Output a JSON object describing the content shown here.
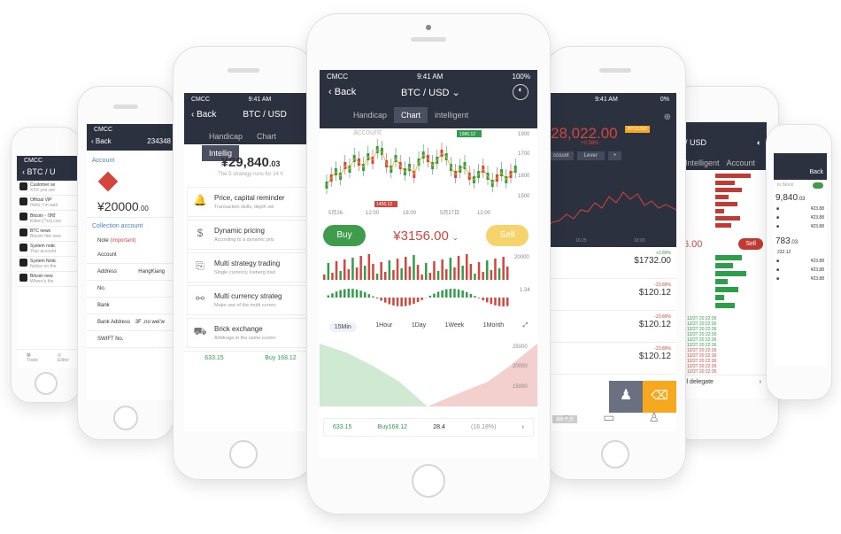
{
  "colors": {
    "dark": "#2c3140",
    "green": "#2f9e4a",
    "red": "#d4453d",
    "yellow": "#f6d36b",
    "orange": "#f5a623"
  },
  "p1": {
    "status": "CMCC",
    "title": "BTC / U",
    "news": [
      {
        "title": "Customer se",
        "sub": "XXX you are"
      },
      {
        "title": "Official VIP",
        "sub": "Hello, I'm wait"
      },
      {
        "title": "Bitcoin - 대략",
        "sub": "Kitten [?xx] coin"
      },
      {
        "title": "BTC news",
        "sub": "Bitcoin hits new"
      },
      {
        "title": "System notic",
        "sub": "Your account"
      },
      {
        "title": "System Notic",
        "sub": "Notice on the"
      },
      {
        "title": "Bitcoin new",
        "sub": "Where's the"
      }
    ],
    "nav": [
      "Trade",
      "Editor"
    ]
  },
  "p2": {
    "status": "CMCC",
    "back": "Back",
    "title": "234348",
    "account": "Account",
    "amount": "¥20000",
    "amount_dec": ".00",
    "collection": "Collection account",
    "note": "Note",
    "important": "(important)",
    "fields": [
      "Account",
      "Address",
      "No.",
      "Bank",
      "Bank Address",
      "SWIFT No."
    ],
    "address_val": "HangKiang",
    "bank_addr_val": "3F ,no wei'w"
  },
  "p3": {
    "status": "CMCC",
    "time": "9:41 AM",
    "back": "Back",
    "title": "BTC / USD",
    "tabs": [
      "Handicap",
      "Chart",
      "Intellig"
    ],
    "price": "¥29,840",
    "price_dec": ".03",
    "note": "The 5 strategy runs for 24 h",
    "items": [
      {
        "title": "Price, capital reminder",
        "sub": "Transaction skills, depth sel"
      },
      {
        "title": "Dynamic pricing",
        "sub": "According to a dynamic pric"
      },
      {
        "title": "Multi strategy trading",
        "sub": "Single currency Iceberg trad"
      },
      {
        "title": "Multi currency strateg",
        "sub": "Make use of the multi curren"
      },
      {
        "title": "Brick exchange",
        "sub": "Arbitrage in the same curren"
      }
    ],
    "foot_left": "633.15",
    "foot_right": "Buy 168.12"
  },
  "p4": {
    "status": "CMCC",
    "time": "9:41 AM",
    "battery": "100%",
    "back": "Back",
    "title": "BTC / USD",
    "tabs": [
      "Handicap",
      "Chart",
      "intelligent",
      "account"
    ],
    "price_axis": [
      "1900",
      "1700",
      "1600",
      "1500"
    ],
    "dates": [
      "5月26",
      "12:00",
      "18:00",
      "5月27日",
      "12:00"
    ],
    "hi": "1986.12",
    "lo": "1456.12",
    "buy": "Buy",
    "price": "¥3156.00",
    "sell": "Sell",
    "vol_max": "20000",
    "macd": "1.34",
    "periods": [
      "15Min",
      "1Hour",
      "1Day",
      "1Week",
      "1Month"
    ],
    "depth_axis": [
      "25000",
      "20000",
      "15000"
    ],
    "foot": {
      "a": "633.15",
      "b": "Buy168.12",
      "c": "28.4",
      "d": "(16.18%)"
    }
  },
  "p5": {
    "time": "9:41 AM",
    "battery": "0%",
    "price": "28,022.00",
    "badge": "BTC/USD",
    "change": "+0.58%",
    "tabs": [
      "ccount",
      "Lever",
      "+"
    ],
    "axis": [
      "16:25",
      "18:00"
    ],
    "rows": [
      {
        "chg": "+3.89%",
        "val": "$1732.00"
      },
      {
        "chg": "-23.89%",
        "val": "$120.12"
      },
      {
        "chg": "-23.89%",
        "val": "$120.12"
      },
      {
        "chg": "-23.89%",
        "val": "$120.12"
      }
    ],
    "tag": "最新成交"
  },
  "p6": {
    "title": "/ USD",
    "tabs": [
      "Intelligent",
      "Account"
    ],
    "price": "6.00",
    "sell": "Sell",
    "rows": [
      "12/27 20:22:36",
      "12/27 20:22:36",
      "12/27 20:22:36",
      "12/27 20:22:36",
      "12/27 20:22:36",
      "12/27 20:22:36",
      "12/27 20:22:36",
      "12/27 20:22:36",
      "12/27 20:22:36",
      "12/27 20:22:36",
      "12/27 20:22:36"
    ],
    "delegate": "ll delegate"
  },
  "p7": {
    "back": "Back",
    "toggle": "In Stock",
    "p1": "9,840",
    "p1d": ".03",
    "vals": [
      "¥23.88",
      "¥23.88",
      "¥23.88"
    ],
    "p2": "783",
    "p2d": ".03",
    "p3": "232.12",
    "vals2": [
      "¥23.88",
      "¥23.88",
      "¥23.88"
    ]
  }
}
